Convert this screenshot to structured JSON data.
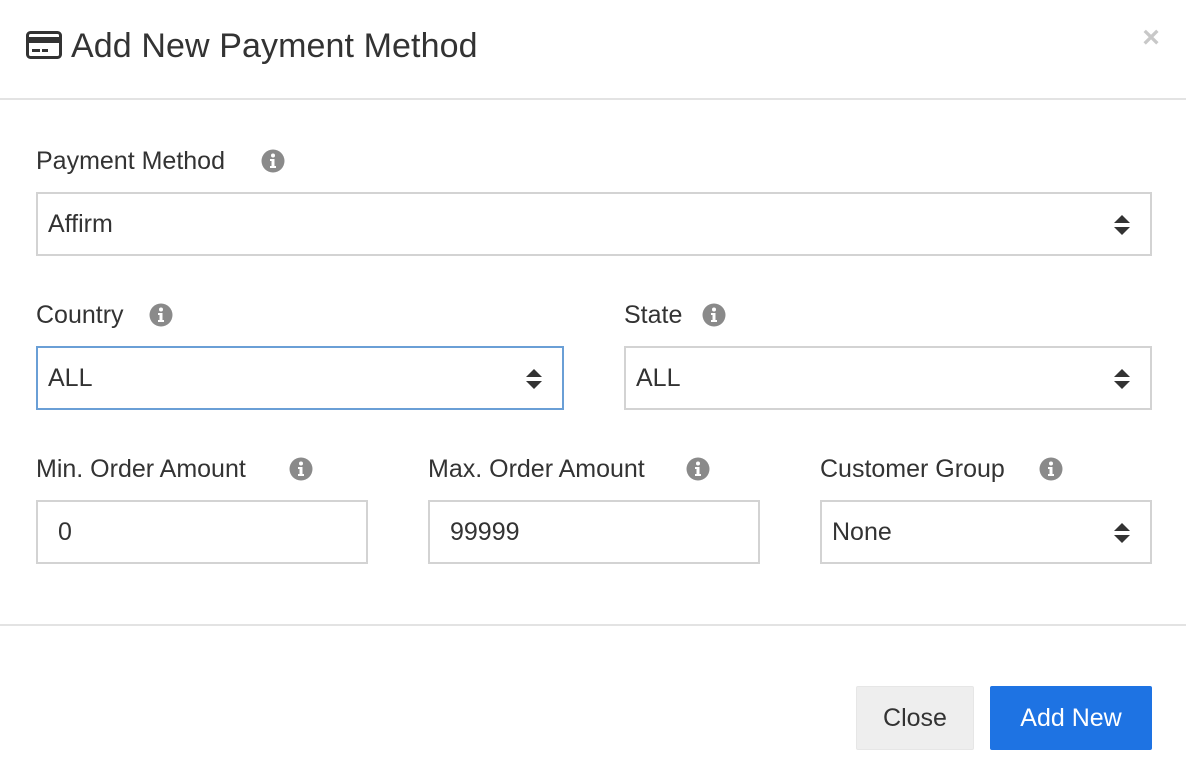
{
  "dialog": {
    "title": "Add New Payment Method",
    "title_icon": "credit-card-icon",
    "close_icon": "close-icon",
    "close_glyph": "×"
  },
  "form": {
    "payment_method": {
      "label": "Payment Method",
      "value": "Affirm",
      "info_icon": "info-icon"
    },
    "country": {
      "label": "Country",
      "value": "ALL",
      "info_icon": "info-icon"
    },
    "state": {
      "label": "State",
      "value": "ALL",
      "info_icon": "info-icon"
    },
    "min_order_amount": {
      "label": "Min. Order Amount",
      "value": "0",
      "info_icon": "info-icon"
    },
    "max_order_amount": {
      "label": "Max. Order Amount",
      "value": "99999",
      "info_icon": "info-icon"
    },
    "customer_group": {
      "label": "Customer Group",
      "value": "None",
      "info_icon": "info-icon"
    }
  },
  "footer": {
    "close_label": "Close",
    "add_label": "Add New"
  },
  "colors": {
    "primary": "#1e73e3",
    "focus_border": "#6a9fd6",
    "field_border": "#d3d3d3",
    "info_icon": "#8a8a8a"
  }
}
